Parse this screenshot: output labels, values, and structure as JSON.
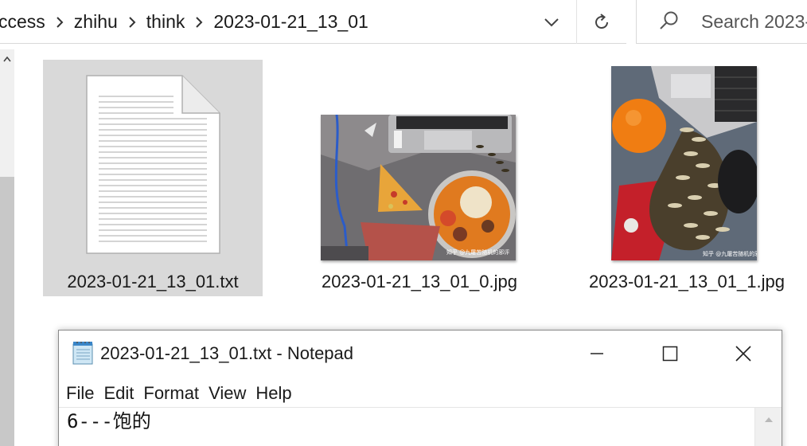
{
  "explorer": {
    "breadcrumb": [
      "ccess",
      "zhihu",
      "think",
      "2023-01-21_13_01"
    ],
    "search_placeholder": "Search 2023-0"
  },
  "files": [
    {
      "name": "2023-01-21_13_01.txt",
      "type": "text-document-icon",
      "selected": true
    },
    {
      "name": "2023-01-21_13_01_0.jpg",
      "type": "image",
      "watermark": "知乎 @九屠苦随机的邪评"
    },
    {
      "name": "2023-01-21_13_01_1.jpg",
      "type": "image",
      "watermark": "知乎 @九屠苦随机的邪评"
    }
  ],
  "notepad": {
    "title": "2023-01-21_13_01.txt - Notepad",
    "menu": [
      "File",
      "Edit",
      "Format",
      "View",
      "Help"
    ],
    "content": "6---饱的"
  },
  "colors": {
    "selected_tile_bg": "#d9d9d9",
    "window_bg": "#ffffff",
    "scrollbar_thumb": "#c8c8c8"
  }
}
